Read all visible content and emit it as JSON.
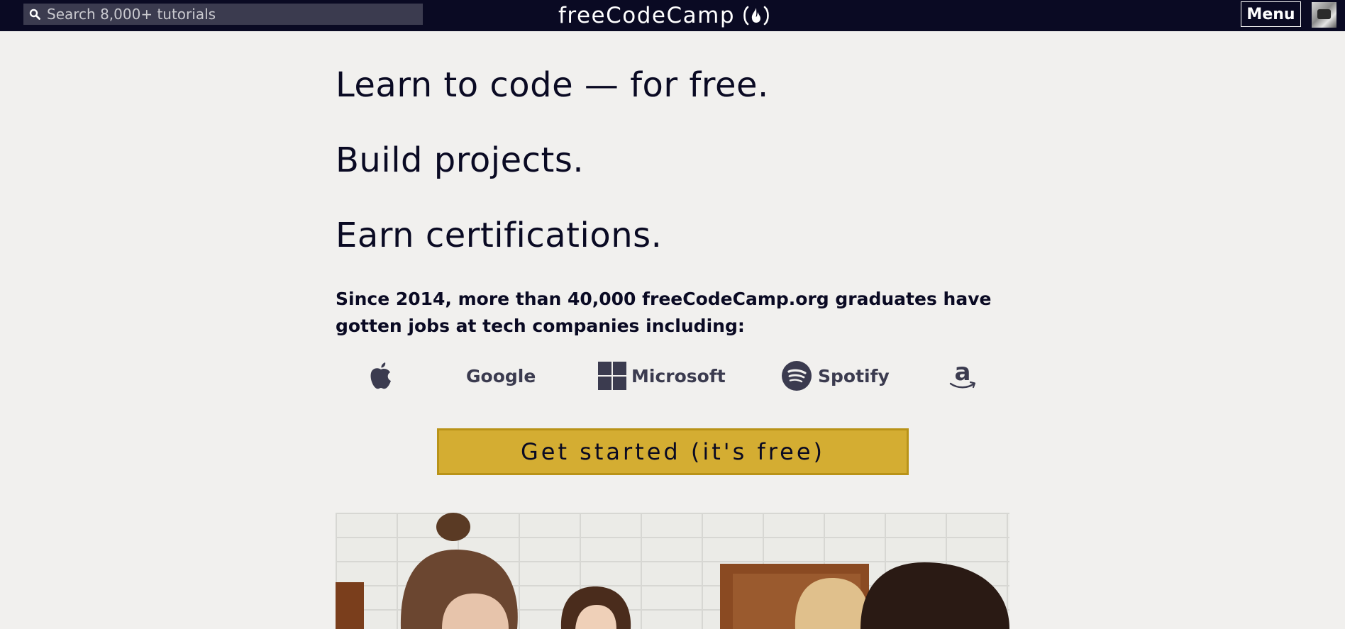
{
  "header": {
    "search_placeholder": "Search 8,000+ tutorials",
    "logo_text": "freeCodeCamp",
    "menu_label": "Menu"
  },
  "main": {
    "headlines": [
      "Learn to code — for free.",
      "Build projects.",
      "Earn certifications."
    ],
    "since_text": "Since 2014, more than 40,000 freeCodeCamp.org graduates have gotten jobs at tech companies including:",
    "companies": [
      {
        "name": "",
        "icon": "apple-icon"
      },
      {
        "name": "Google",
        "icon": ""
      },
      {
        "name": "Microsoft",
        "icon": "microsoft-icon"
      },
      {
        "name": "Spotify",
        "icon": "spotify-icon"
      },
      {
        "name": "",
        "icon": "amazon-icon"
      }
    ],
    "cta_label": "Get started (it's free)"
  },
  "colors": {
    "navbar": "#0a0a23",
    "search_bg": "#3b3b4f",
    "page_bg": "#f1f0ee",
    "cta_bg": "#d4ad32",
    "cta_border": "#b99318",
    "text": "#0a0a23",
    "logo_gray": "#3b3b4f"
  }
}
